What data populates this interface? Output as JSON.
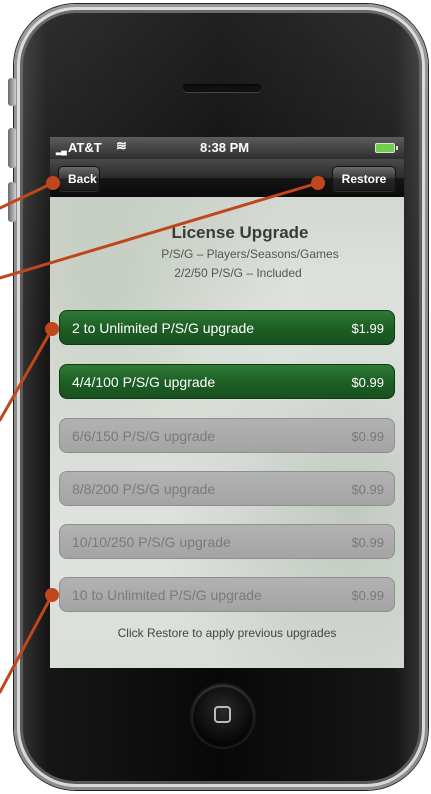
{
  "status_bar": {
    "signal": "▂▄",
    "carrier": "AT&T",
    "wifi": "≋",
    "time": "8:38 PM",
    "battery_color": "#6cd04a"
  },
  "nav_bar": {
    "back_label": "Back",
    "restore_label": "Restore"
  },
  "header": {
    "title": "License Upgrade",
    "subtitle": "P/S/G – Players/Seasons/Games",
    "included": "2/2/50 P/S/G – Included"
  },
  "upgrades": [
    {
      "name": "2 to Unlimited P/S/G upgrade",
      "price": "$1.99",
      "state": "active"
    },
    {
      "name": "4/4/100 P/S/G upgrade",
      "price": "$0.99",
      "state": "active"
    },
    {
      "name": "6/6/150 P/S/G upgrade",
      "price": "$0.99",
      "state": "inactive"
    },
    {
      "name": "8/8/200 P/S/G upgrade",
      "price": "$0.99",
      "state": "inactive"
    },
    {
      "name": "10/10/250 P/S/G upgrade",
      "price": "$0.99",
      "state": "inactive"
    },
    {
      "name": "10 to Unlimited P/S/G upgrade",
      "price": "$0.99",
      "state": "inactive"
    }
  ],
  "footer": {
    "hint": "Click Restore to apply previous upgrades"
  },
  "colors": {
    "active_green": "#1e5f25",
    "inactive_gray": "#a4a4a4",
    "annotation_line": "#c0461c"
  },
  "icons": {
    "home": "home-button-icon",
    "wifi": "wifi-icon",
    "battery": "battery-icon",
    "signal": "signal-icon"
  }
}
